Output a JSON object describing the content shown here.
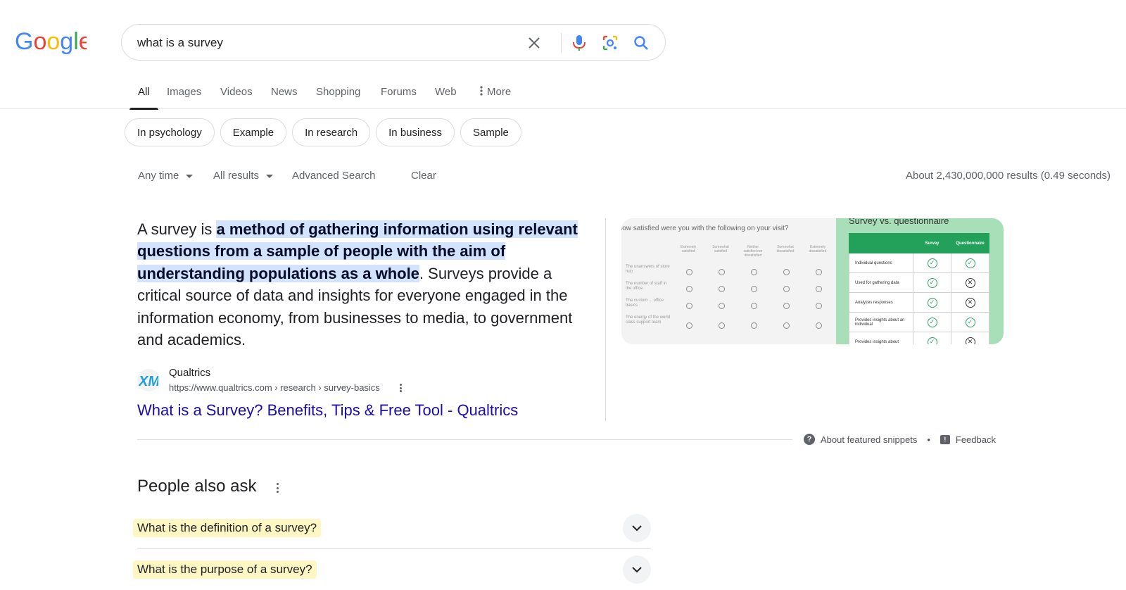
{
  "header": {
    "logo_text": "Google",
    "search_query": "what is a survey"
  },
  "tabs": [
    {
      "label": "All",
      "active": true
    },
    {
      "label": "Images"
    },
    {
      "label": "Videos"
    },
    {
      "label": "News"
    },
    {
      "label": "Shopping"
    },
    {
      "label": "Forums"
    },
    {
      "label": "Web"
    },
    {
      "label": "More"
    }
  ],
  "chips": [
    "In psychology",
    "Example",
    "In research",
    "In business",
    "Sample"
  ],
  "tools": {
    "any_time": "Any time",
    "all_results": "All results",
    "advanced_search": "Advanced Search",
    "clear": "Clear",
    "result_stats": "About 2,430,000,000 results (0.49 seconds)"
  },
  "featured_snippet": {
    "text_before": "A survey is ",
    "highlight": "a method of gathering information using relevant questions from a sample of people with the aim of understanding populations as a whole",
    "text_after": ". Surveys provide a critical source of data and insights for everyone engaged in the information economy, from businesses to media, to government and academics.",
    "source_name": "Qualtrics",
    "source_url": "https://www.qualtrics.com › research › survey-basics",
    "result_title": "What is a Survey? Benefits, Tips & Free Tool - Qualtrics",
    "image1": {
      "caption": "How satisfied were you with the following on your visit?",
      "column_headers": [
        "Extremely satisfied",
        "Somewhat satisfied",
        "Neither satisfied nor dissatisfied",
        "Somewhat dissatisfied",
        "Extremely dissatisfied"
      ],
      "rows": [
        "The unanswers of store hub",
        "The number of staff in the office",
        "The custom ... office basics",
        "The energy of the world class support team"
      ]
    },
    "image2": {
      "caption": "Survey vs. questionnaire",
      "headers": [
        "",
        "Survey",
        "Questionnaire"
      ],
      "rows": [
        {
          "label": "Individual questions",
          "survey": "check",
          "questionnaire": "check"
        },
        {
          "label": "Used for gathering data",
          "survey": "check",
          "questionnaire": "cross"
        },
        {
          "label": "Analyzes responses",
          "survey": "check",
          "questionnaire": "cross"
        },
        {
          "label": "Provides insights about an individual",
          "survey": "check",
          "questionnaire": "check"
        },
        {
          "label": "Provides insights about",
          "survey": "check",
          "questionnaire": "cross"
        }
      ]
    },
    "footer": {
      "about": "About featured snippets",
      "separator": "•",
      "feedback": "Feedback"
    }
  },
  "people_also_ask": {
    "title": "People also ask",
    "questions": [
      "What is the definition of a survey?",
      "What is the purpose of a survey?"
    ]
  }
}
